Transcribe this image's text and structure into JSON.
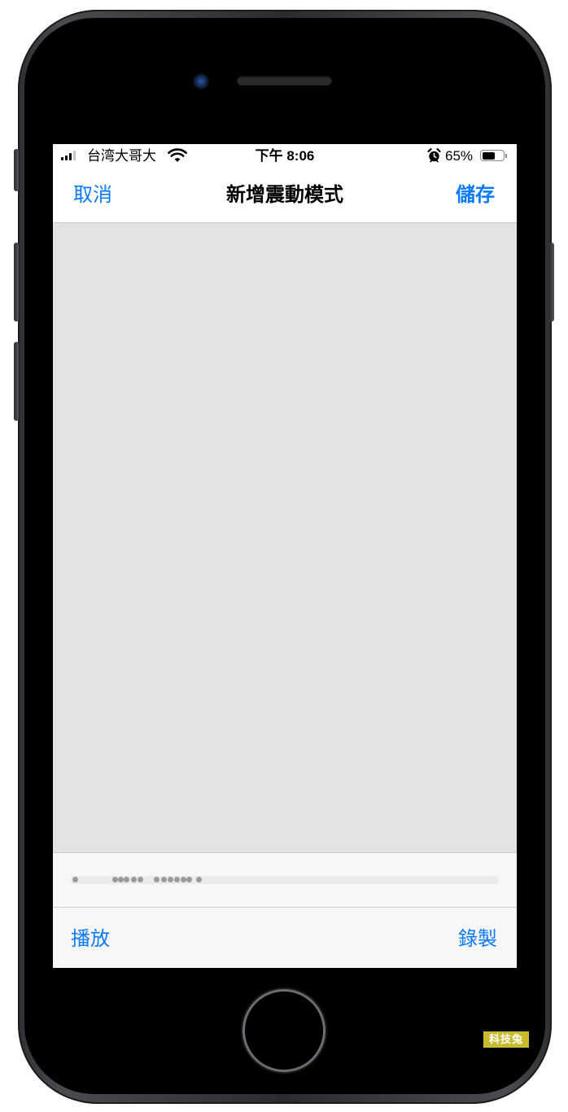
{
  "status_bar": {
    "carrier": "台湾大哥大",
    "time": "下午 8:06",
    "battery_percent": "65%",
    "battery_level": 0.65,
    "signal_bars_active": 3,
    "signal_bars_total": 4,
    "icons": [
      "signal-icon",
      "wifi-icon",
      "alarm-icon",
      "battery-icon"
    ]
  },
  "nav_bar": {
    "cancel_label": "取消",
    "title": "新增震動模式",
    "save_label": "儲存"
  },
  "toolbar": {
    "play_label": "播放",
    "record_label": "錄製"
  },
  "watermark": {
    "text": "科技兔"
  },
  "colors": {
    "accent": "#0a7aff",
    "tap_area": "#e3e3e3",
    "toolbar_bg": "#f7f7f7",
    "pulse": "#9a9a9a",
    "watermark_bg": "#c8bb2e"
  }
}
